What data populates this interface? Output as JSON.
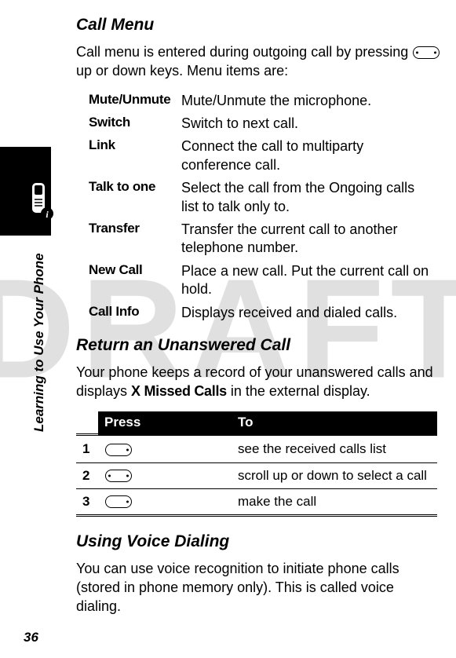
{
  "watermark": "DRAFT",
  "side_label": "Learning to Use Your Phone",
  "page_number": "36",
  "section1": {
    "heading": "Call Menu",
    "intro_before_icon": "Call menu is entered during outgoing call by pressing ",
    "intro_after_icon": " up or down keys. Menu items are:",
    "items": [
      {
        "term": "Mute/Unmute",
        "desc": "Mute/Unmute the microphone."
      },
      {
        "term": "Switch",
        "desc": "Switch to next call."
      },
      {
        "term": "Link",
        "desc": "Connect the call to multiparty conference call."
      },
      {
        "term": "Talk to one",
        "desc": "Select the call from the Ongoing calls list to talk only to."
      },
      {
        "term": "Transfer",
        "desc": "Transfer the current call to another telephone number."
      },
      {
        "term": "New Call",
        "desc": "Place a new call. Put the current call on hold."
      },
      {
        "term": "Call Info",
        "desc": "Displays received and dialed calls."
      }
    ]
  },
  "section2": {
    "heading": "Return an Unanswered Call",
    "intro_before": "Your phone keeps a record of your unanswered calls and displays ",
    "missed_label": "X Missed Calls",
    "intro_after": " in the external display.",
    "table": {
      "head_press": "Press",
      "head_to": "To",
      "rows": [
        {
          "num": "1",
          "to": "see the received calls list"
        },
        {
          "num": "2",
          "to": "scroll up or down to select a call"
        },
        {
          "num": "3",
          "to": "make the call"
        }
      ]
    }
  },
  "section3": {
    "heading": "Using Voice Dialing",
    "intro": "You can use voice recognition to initiate phone calls (stored in phone memory only). This is called voice dialing."
  }
}
